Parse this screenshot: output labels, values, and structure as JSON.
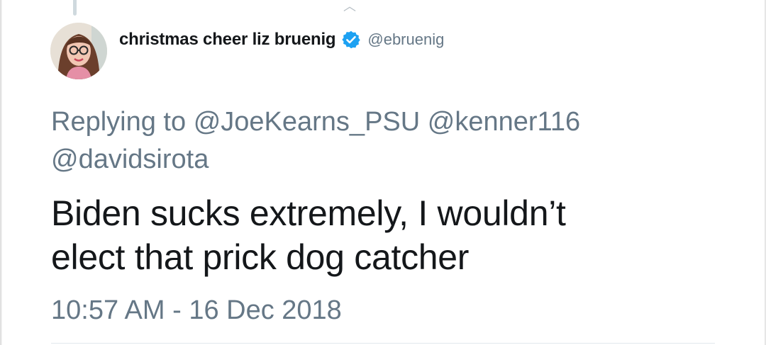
{
  "user": {
    "display_name": "christmas cheer liz bruenig",
    "handle": "@ebruenig",
    "verified": true,
    "verified_color": "#1da1f2"
  },
  "reply": {
    "prefix": "Replying to",
    "mentions": [
      "@JoeKearns_PSU",
      "@kenner116",
      "@davidsirota"
    ]
  },
  "tweet": {
    "text_line1": "Biden sucks extremely, I wouldn’t",
    "text_line2": "elect that prick dog catcher",
    "timestamp": "10:57 AM - 16 Dec 2018"
  },
  "colors": {
    "text_primary": "#14171a",
    "text_secondary": "#657786",
    "divider": "#e1e8ed"
  },
  "icons": {
    "verified": "verified-badge-icon",
    "avatar": "profile-photo"
  }
}
